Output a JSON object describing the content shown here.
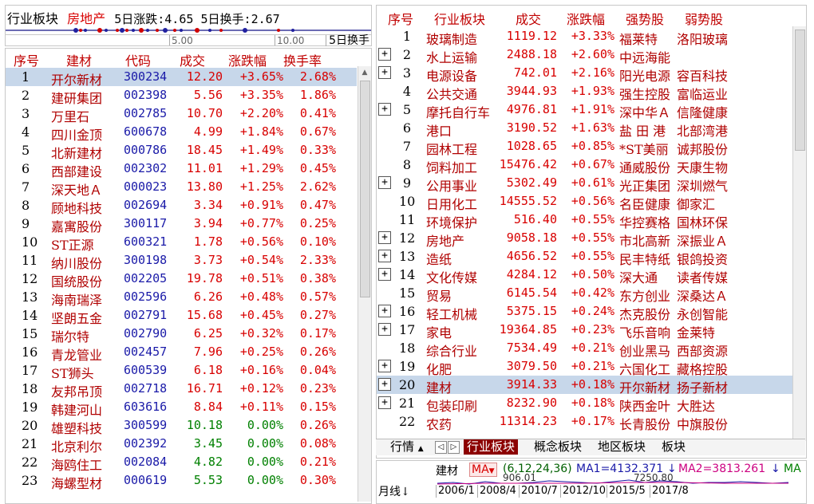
{
  "left_panel": {
    "sector_label": "行业板块",
    "sector_name": "房地产",
    "stat_5d_change_label": "5日涨跌:",
    "stat_5d_change_value": "4.65",
    "stat_5d_turnover_label": "5日换手:",
    "stat_5d_turnover_value": "2.67",
    "axis_tick_1": "5.00",
    "axis_tick_2": "10.00",
    "axis_right_label": "5日换手"
  },
  "stock_list": {
    "headers": [
      "序号",
      "建材",
      "代码",
      "成交",
      "涨跌幅",
      "换手率"
    ],
    "rows": [
      {
        "no": "1",
        "name": "开尔新材",
        "code": "300234",
        "price": "12.20",
        "pct": "+3.65%",
        "turnover": "2.68%",
        "dir": "up",
        "selected": true
      },
      {
        "no": "2",
        "name": "建研集团",
        "code": "002398",
        "price": "5.56",
        "pct": "+3.35%",
        "turnover": "1.86%",
        "dir": "up"
      },
      {
        "no": "3",
        "name": "万里石",
        "code": "002785",
        "price": "10.70",
        "pct": "+2.20%",
        "turnover": "0.41%",
        "dir": "up"
      },
      {
        "no": "4",
        "name": "四川金顶",
        "code": "600678",
        "price": "4.99",
        "pct": "+1.84%",
        "turnover": "0.67%",
        "dir": "up"
      },
      {
        "no": "5",
        "name": "北新建材",
        "code": "000786",
        "price": "18.45",
        "pct": "+1.49%",
        "turnover": "0.33%",
        "dir": "up"
      },
      {
        "no": "6",
        "name": "西部建设",
        "code": "002302",
        "price": "11.01",
        "pct": "+1.29%",
        "turnover": "0.45%",
        "dir": "up"
      },
      {
        "no": "7",
        "name": "深天地Ａ",
        "code": "000023",
        "price": "13.80",
        "pct": "+1.25%",
        "turnover": "2.62%",
        "dir": "up"
      },
      {
        "no": "8",
        "name": "顾地科技",
        "code": "002694",
        "price": "3.34",
        "pct": "+0.91%",
        "turnover": "0.47%",
        "dir": "up"
      },
      {
        "no": "9",
        "name": "嘉寓股份",
        "code": "300117",
        "price": "3.94",
        "pct": "+0.77%",
        "turnover": "0.25%",
        "dir": "up"
      },
      {
        "no": "10",
        "name": "ST正源",
        "code": "600321",
        "price": "1.78",
        "pct": "+0.56%",
        "turnover": "0.10%",
        "dir": "up"
      },
      {
        "no": "11",
        "name": "纳川股份",
        "code": "300198",
        "price": "3.73",
        "pct": "+0.54%",
        "turnover": "2.33%",
        "dir": "up"
      },
      {
        "no": "12",
        "name": "国统股份",
        "code": "002205",
        "price": "19.78",
        "pct": "+0.51%",
        "turnover": "0.38%",
        "dir": "up"
      },
      {
        "no": "13",
        "name": "海南瑞泽",
        "code": "002596",
        "price": "6.26",
        "pct": "+0.48%",
        "turnover": "0.57%",
        "dir": "up"
      },
      {
        "no": "14",
        "name": "坚朗五金",
        "code": "002791",
        "price": "15.68",
        "pct": "+0.45%",
        "turnover": "0.27%",
        "dir": "up"
      },
      {
        "no": "15",
        "name": "瑞尔特",
        "code": "002790",
        "price": "6.25",
        "pct": "+0.32%",
        "turnover": "0.17%",
        "dir": "up"
      },
      {
        "no": "16",
        "name": "青龙管业",
        "code": "002457",
        "price": "7.96",
        "pct": "+0.25%",
        "turnover": "0.26%",
        "dir": "up"
      },
      {
        "no": "17",
        "name": "ST狮头",
        "code": "600539",
        "price": "6.18",
        "pct": "+0.16%",
        "turnover": "0.04%",
        "dir": "up"
      },
      {
        "no": "18",
        "name": "友邦吊顶",
        "code": "002718",
        "price": "16.71",
        "pct": "+0.12%",
        "turnover": "0.23%",
        "dir": "up"
      },
      {
        "no": "19",
        "name": "韩建河山",
        "code": "603616",
        "price": "8.84",
        "pct": "+0.11%",
        "turnover": "0.15%",
        "dir": "up"
      },
      {
        "no": "20",
        "name": "雄塑科技",
        "code": "300599",
        "price": "10.18",
        "pct": "0.00%",
        "turnover": "0.26%",
        "dir": "flat"
      },
      {
        "no": "21",
        "name": "北京利尔",
        "code": "002392",
        "price": "3.45",
        "pct": "0.00%",
        "turnover": "0.08%",
        "dir": "flat"
      },
      {
        "no": "22",
        "name": "海鸥住工",
        "code": "002084",
        "price": "4.82",
        "pct": "0.00%",
        "turnover": "0.21%",
        "dir": "flat"
      },
      {
        "no": "23",
        "name": "海螺型材",
        "code": "000619",
        "price": "5.53",
        "pct": "0.00%",
        "turnover": "0.30%",
        "dir": "flat"
      }
    ]
  },
  "sector_table": {
    "headers": [
      "序号",
      "行业板块",
      "成交",
      "涨跌幅",
      "强势股",
      "弱势股"
    ],
    "rows": [
      {
        "no": "1",
        "name": "玻璃制造",
        "value": "1119.12",
        "pct": "+3.33%",
        "strong": "福莱特",
        "weak": "洛阳玻璃",
        "expand": false
      },
      {
        "no": "2",
        "name": "水上运输",
        "value": "2488.18",
        "pct": "+2.60%",
        "strong": "中远海能",
        "weak": "",
        "expand": true
      },
      {
        "no": "3",
        "name": "电源设备",
        "value": "742.01",
        "pct": "+2.16%",
        "strong": "阳光电源",
        "weak": "容百科技",
        "expand": true
      },
      {
        "no": "4",
        "name": "公共交通",
        "value": "3944.93",
        "pct": "+1.93%",
        "strong": "强生控股",
        "weak": "富临运业",
        "expand": false
      },
      {
        "no": "5",
        "name": "摩托自行车",
        "value": "4976.81",
        "pct": "+1.91%",
        "strong": "深中华Ａ",
        "weak": "信隆健康",
        "expand": true
      },
      {
        "no": "6",
        "name": "港口",
        "value": "3190.52",
        "pct": "+1.63%",
        "strong": "盐 田 港",
        "weak": "北部湾港",
        "expand": false
      },
      {
        "no": "7",
        "name": "园林工程",
        "value": "1028.65",
        "pct": "+0.85%",
        "strong": "*ST美丽",
        "weak": "诚邦股份",
        "expand": false
      },
      {
        "no": "8",
        "name": "饲料加工",
        "value": "15476.42",
        "pct": "+0.67%",
        "strong": "通威股份",
        "weak": "天康生物",
        "expand": false
      },
      {
        "no": "9",
        "name": "公用事业",
        "value": "5302.49",
        "pct": "+0.61%",
        "strong": "光正集团",
        "weak": "深圳燃气",
        "expand": true
      },
      {
        "no": "10",
        "name": "日用化工",
        "value": "14555.52",
        "pct": "+0.56%",
        "strong": "名臣健康",
        "weak": "御家汇",
        "expand": false
      },
      {
        "no": "11",
        "name": "环境保护",
        "value": "516.40",
        "pct": "+0.55%",
        "strong": "华控赛格",
        "weak": "国林环保",
        "expand": false
      },
      {
        "no": "12",
        "name": "房地产",
        "value": "9058.18",
        "pct": "+0.55%",
        "strong": "市北高新",
        "weak": "深振业Ａ",
        "expand": true
      },
      {
        "no": "13",
        "name": "造纸",
        "value": "4656.52",
        "pct": "+0.55%",
        "strong": "民丰特纸",
        "weak": "银鸽投资",
        "expand": true
      },
      {
        "no": "14",
        "name": "文化传媒",
        "value": "4284.12",
        "pct": "+0.50%",
        "strong": "深大通",
        "weak": "读者传媒",
        "expand": true
      },
      {
        "no": "15",
        "name": "贸易",
        "value": "6145.54",
        "pct": "+0.42%",
        "strong": "东方创业",
        "weak": "深桑达Ａ",
        "expand": false
      },
      {
        "no": "16",
        "name": "轻工机械",
        "value": "5375.15",
        "pct": "+0.24%",
        "strong": "杰克股份",
        "weak": "永创智能",
        "expand": true
      },
      {
        "no": "17",
        "name": "家电",
        "value": "19364.85",
        "pct": "+0.23%",
        "strong": "飞乐音响",
        "weak": "金莱特",
        "expand": true
      },
      {
        "no": "18",
        "name": "综合行业",
        "value": "7534.49",
        "pct": "+0.21%",
        "strong": "创业黑马",
        "weak": "西部资源",
        "expand": false
      },
      {
        "no": "19",
        "name": "化肥",
        "value": "3079.50",
        "pct": "+0.21%",
        "strong": "六国化工",
        "weak": "藏格控股",
        "expand": true
      },
      {
        "no": "20",
        "name": "建材",
        "value": "3914.33",
        "pct": "+0.18%",
        "strong": "开尔新材",
        "weak": "扬子新材",
        "expand": true,
        "selected": true
      },
      {
        "no": "21",
        "name": "包装印刷",
        "value": "8232.90",
        "pct": "+0.18%",
        "strong": "陕西金叶",
        "weak": "大胜达",
        "expand": true
      },
      {
        "no": "22",
        "name": "农药",
        "value": "11314.23",
        "pct": "+0.17%",
        "strong": "长青股份",
        "weak": "中旗股份",
        "expand": false
      }
    ]
  },
  "tabs": {
    "quote_label": "行情",
    "quote_marker": "▲",
    "nav_prev": "◁",
    "nav_next": "▷",
    "industry": "行业板块",
    "concept": "概念板块",
    "region": "地区板块",
    "more": "板块"
  },
  "mini_chart": {
    "sector": "建材",
    "indicator": "MA",
    "params": "(6,12,24,36)",
    "ma1": "MA1=4132.371",
    "ma1_arrow": "↓",
    "ma2": "MA2=3813.261",
    "ma2_arrow": "↓",
    "ma3_partial": "MA",
    "period": "月线",
    "period_arrow": "↓",
    "years": [
      "2006/1",
      "2008/4",
      "2010/7",
      "2012/10",
      "2015/5",
      "2017/8"
    ],
    "low_value": "906.01",
    "high_value": "7250.80"
  },
  "colors": {
    "up": "#d80000",
    "down": "#008000",
    "name": "#b00000",
    "header": "#c00000",
    "selected_row": "#c7d7ea",
    "active_tab": "#8c0000"
  }
}
